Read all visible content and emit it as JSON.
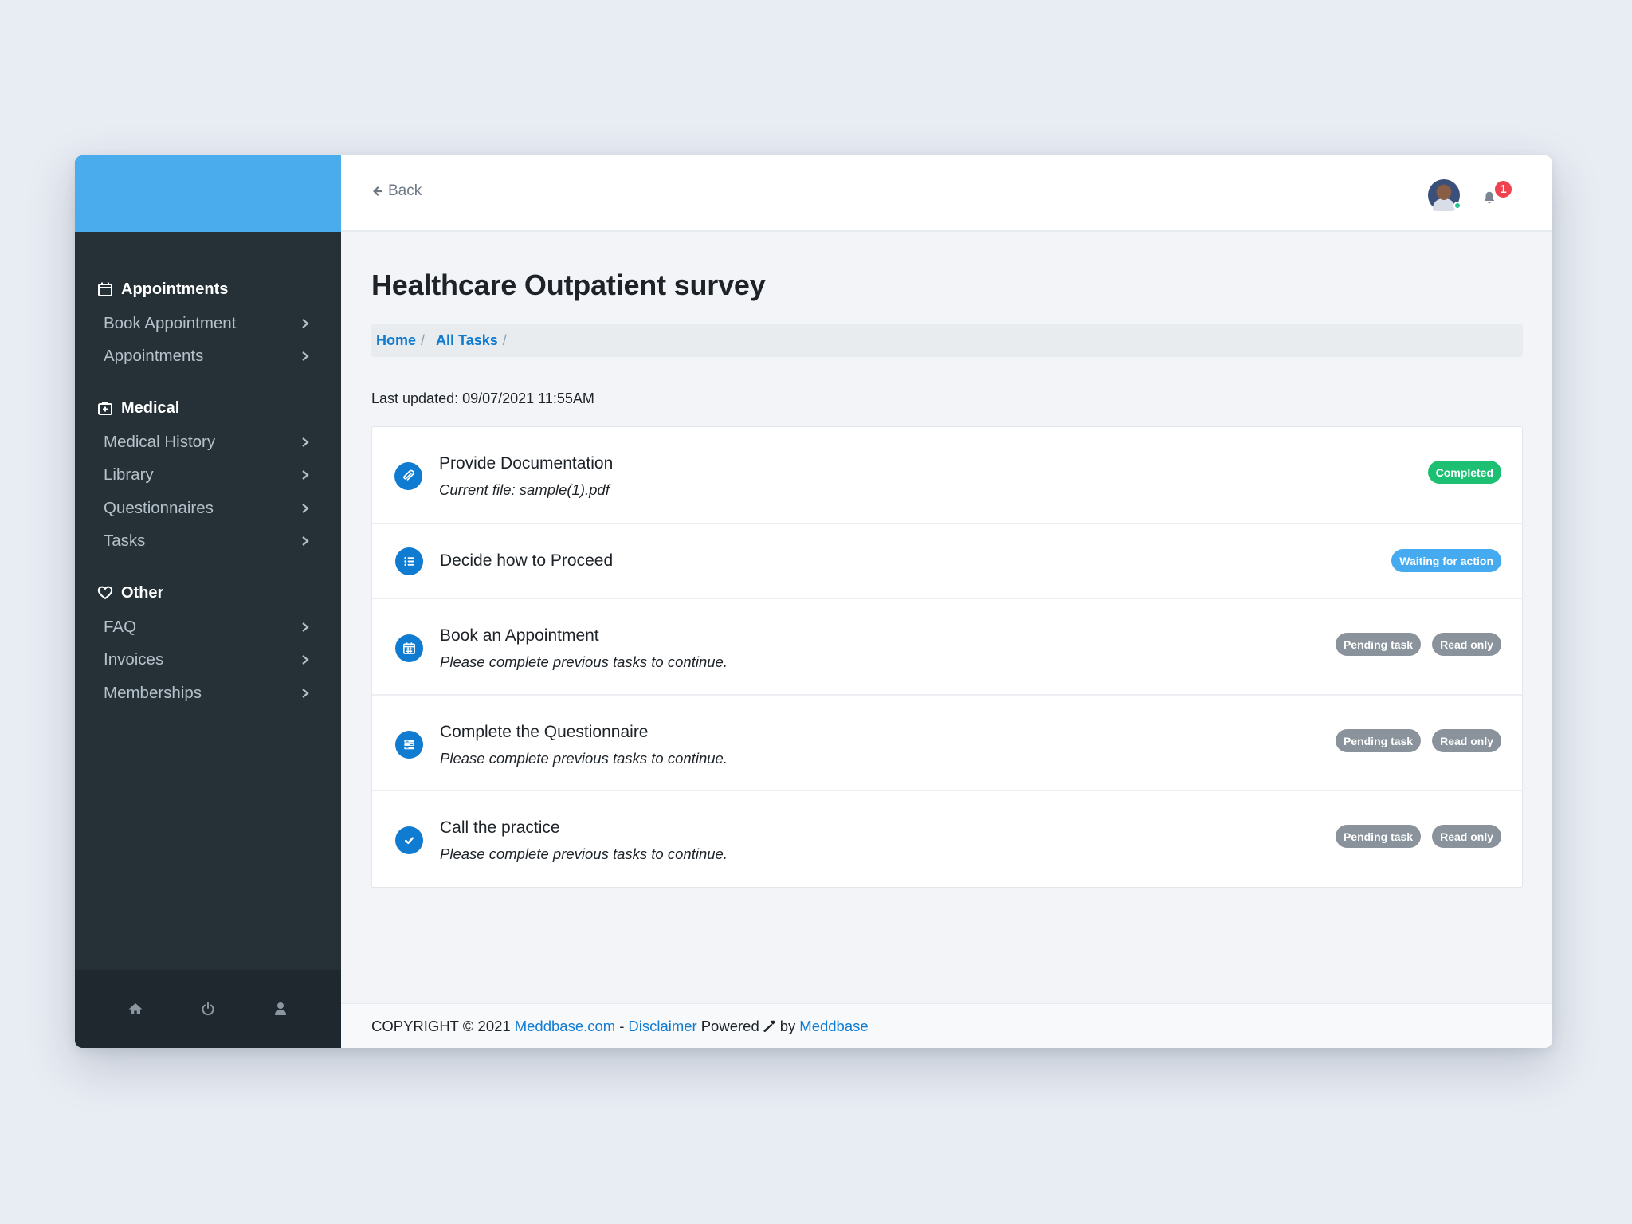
{
  "sidebar": {
    "groups": [
      {
        "title": "Appointments",
        "icon": "calendar-icon",
        "items": [
          "Book Appointment",
          "Appointments"
        ]
      },
      {
        "title": "Medical",
        "icon": "medical-kit-icon",
        "items": [
          "Medical History",
          "Library",
          "Questionnaires",
          "Tasks"
        ]
      },
      {
        "title": "Other",
        "icon": "heart-icon",
        "items": [
          "FAQ",
          "Invoices",
          "Memberships"
        ]
      }
    ],
    "footer_icons": [
      "home-icon",
      "power-icon",
      "user-icon"
    ]
  },
  "topbar": {
    "back_label": "Back",
    "notification_count": "1"
  },
  "page": {
    "title": "Healthcare Outpatient survey",
    "breadcrumb": [
      "Home",
      "All Tasks"
    ],
    "last_updated": "Last updated: 09/07/2021 11:55AM"
  },
  "tasks": [
    {
      "title": "Provide Documentation",
      "subtitle": "Current file: sample(1).pdf",
      "icon": "paperclip-icon",
      "badges": [
        {
          "label": "Completed",
          "color": "#1dbf73"
        }
      ]
    },
    {
      "title": "Decide how to Proceed",
      "subtitle": "",
      "icon": "list-icon",
      "badges": [
        {
          "label": "Waiting for action",
          "color": "#45aaf0"
        }
      ]
    },
    {
      "title": "Book an Appointment",
      "subtitle": "Please complete previous tasks to continue.",
      "icon": "calendar-icon",
      "badges": [
        {
          "label": "Pending task",
          "color": "#8a939c"
        },
        {
          "label": "Read only",
          "color": "#8a939c"
        }
      ]
    },
    {
      "title": "Complete the Questionnaire",
      "subtitle": "Please complete previous tasks to continue.",
      "icon": "form-icon",
      "badges": [
        {
          "label": "Pending task",
          "color": "#8a939c"
        },
        {
          "label": "Read only",
          "color": "#8a939c"
        }
      ]
    },
    {
      "title": "Call the practice",
      "subtitle": "Please complete previous tasks to continue.",
      "icon": "check-icon",
      "badges": [
        {
          "label": "Pending task",
          "color": "#8a939c"
        },
        {
          "label": "Read only",
          "color": "#8a939c"
        }
      ]
    }
  ],
  "footer": {
    "copyright": "COPYRIGHT © 2021",
    "site_link": "Meddbase.com",
    "dash": "-",
    "disclaimer_link": "Disclaimer",
    "powered": "Powered",
    "by": "by",
    "brand_link": "Meddbase"
  },
  "colors": {
    "brand_blue": "#4aabed",
    "sidebar_bg": "#253037",
    "link_blue": "#0f7bd1"
  }
}
